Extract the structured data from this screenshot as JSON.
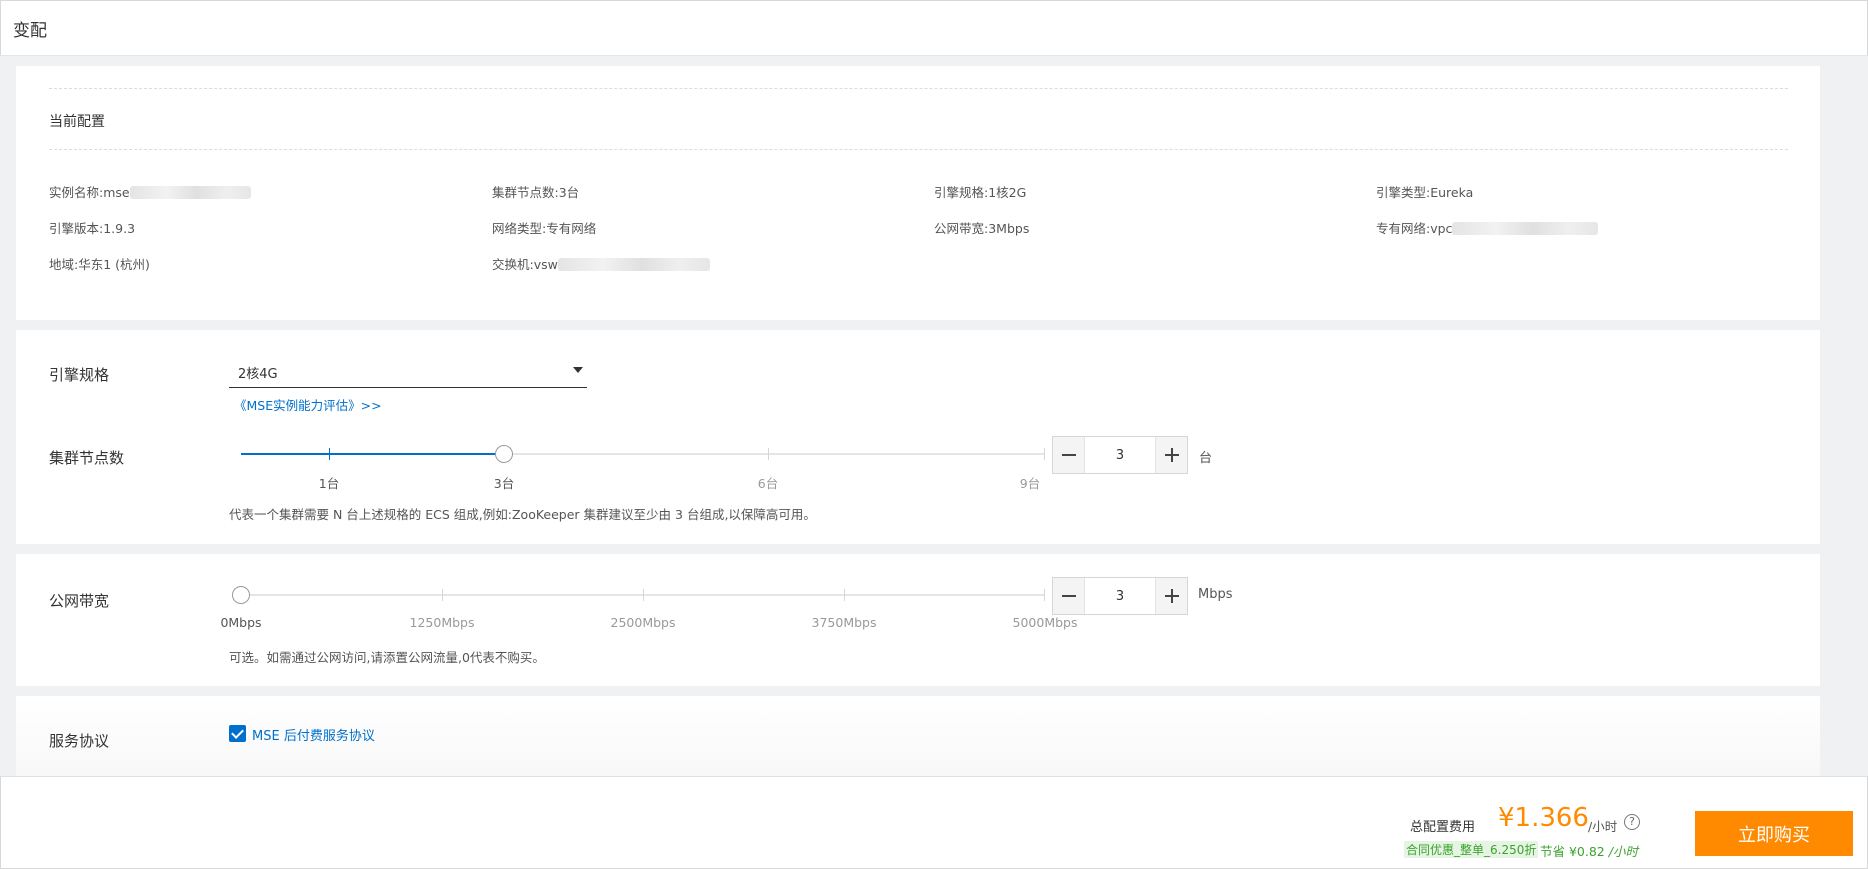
{
  "header": {
    "title": "变配"
  },
  "current_config": {
    "title": "当前配置",
    "items": [
      {
        "label": "实例名称:",
        "value": "mse"
      },
      {
        "label": "集群节点数:",
        "value": "3台"
      },
      {
        "label": "引擎规格:",
        "value": "1核2G"
      },
      {
        "label": "引擎类型:",
        "value": "Eureka"
      },
      {
        "label": "引擎版本:",
        "value": "1.9.3"
      },
      {
        "label": "网络类型:",
        "value": "专有网络"
      },
      {
        "label": "公网带宽:",
        "value": "3Mbps"
      },
      {
        "label": "专有网络:",
        "value": "vpc"
      },
      {
        "label": "地域:",
        "value": "华东1 (杭州)"
      },
      {
        "label": "交换机:",
        "value": "vsw"
      }
    ]
  },
  "engine_spec": {
    "label": "引擎规格",
    "selected": "2核4G",
    "link": "《MSE实例能力评估》>>"
  },
  "cluster_nodes": {
    "label": "集群节点数",
    "marks": [
      "1台",
      "3台",
      "6台",
      "9台"
    ],
    "value": "3",
    "unit": "台",
    "hint": "代表一个集群需要 N 台上述规格的 ECS 组成,例如:ZooKeeper 集群建议至少由 3 台组成,以保障高可用。"
  },
  "bandwidth": {
    "label": "公网带宽",
    "marks": [
      "0Mbps",
      "1250Mbps",
      "2500Mbps",
      "3750Mbps",
      "5000Mbps"
    ],
    "value": "3",
    "unit": "Mbps",
    "hint": "可选。如需通过公网访问,请添置公网流量,0代表不购买。"
  },
  "service": {
    "label": "服务协议",
    "agreement": "MSE 后付费服务协议",
    "checked": true
  },
  "footer": {
    "total_label": "总配置费用",
    "price": "¥1.366",
    "per": "/小时",
    "help": "?",
    "promo": "合同优惠_整单_6.250折",
    "save_prefix": "节省 ¥0.82",
    "save_suffix": "/小时",
    "buy": "立即购买"
  },
  "colors": {
    "accent": "#0070cc",
    "buy": "#ff8a00",
    "promo": "#3aa32d"
  }
}
